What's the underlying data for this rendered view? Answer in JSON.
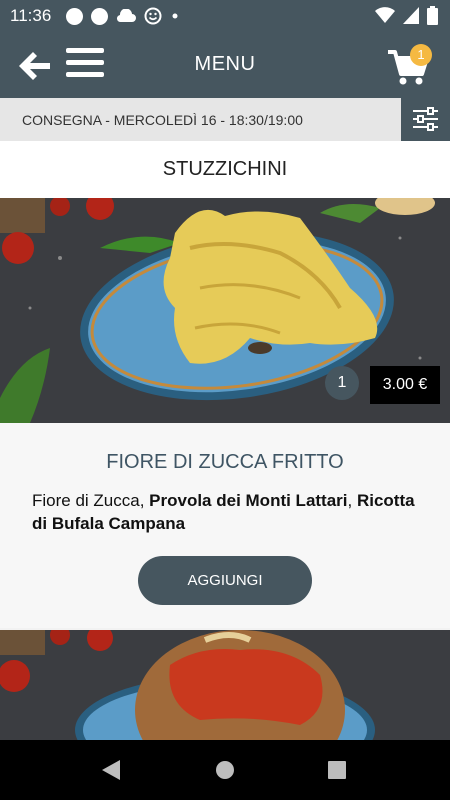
{
  "status_bar": {
    "time": "11:36"
  },
  "app_bar": {
    "title": "MENU",
    "cart_count": "1"
  },
  "delivery": {
    "text": "CONSEGNA - MERCOLEDÌ 16 - 18:30/19:00"
  },
  "section": {
    "title": "STUZZICHINI"
  },
  "product": {
    "quantity": "1",
    "price": "3.00 €",
    "name": "FIORE DI ZUCCA FRITTO",
    "desc_part1": "Fiore di Zucca, ",
    "desc_bold1": "Provola dei Monti Lattari",
    "desc_part2": ", ",
    "desc_bold2": "Ricotta di Bufala Campana",
    "add_label": "AGGIUNGI"
  },
  "colors": {
    "primary": "#46565f",
    "badge": "#f5b942",
    "price_bg": "#000000"
  }
}
